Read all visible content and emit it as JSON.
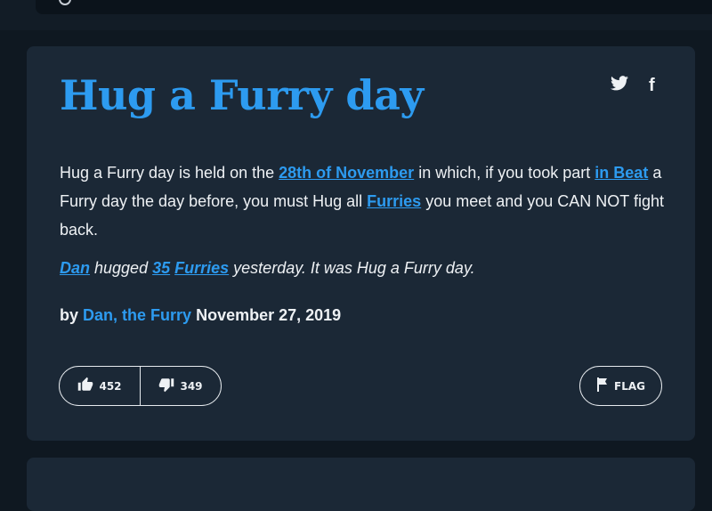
{
  "definition": {
    "word": "Hug a Furry day",
    "meaning": {
      "t1": "Hug a Furry day is held on the ",
      "l1": "28th of November",
      "t2": " in which, if you took part ",
      "l2": "in Beat",
      "t3": " a Furry day the day before, you must Hug all ",
      "l3": "Furries",
      "t4": " you meet and you CAN NOT fight back."
    },
    "example": {
      "l1": "Dan",
      "t1": " hugged ",
      "l2": "35",
      "t2": " ",
      "l3": "Furries",
      "t3": " yesterday. It was Hug a Furry day."
    },
    "by_label": "by",
    "author": "Dan, the Furry",
    "date": "November 27, 2019",
    "thumbs_up": "452",
    "thumbs_down": "349",
    "flag_label": "FLAG"
  },
  "icons": {
    "twitter": "twitter-icon",
    "facebook": "facebook-icon",
    "thumbs_up": "thumbs-up-icon",
    "thumbs_down": "thumbs-down-icon",
    "flag": "flag-icon",
    "search": "search-icon"
  },
  "colors": {
    "accent": "#2d9bf0",
    "card_bg": "#1b2836",
    "page_bg": "#0f1821"
  }
}
